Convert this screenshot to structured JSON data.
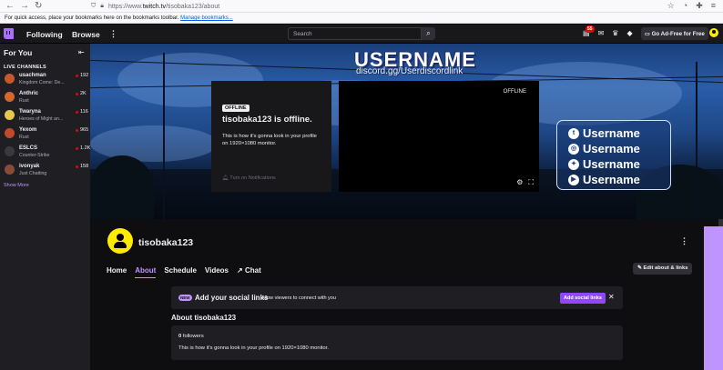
{
  "browser": {
    "url_prefix": "https://www.",
    "url_domain": "twitch.tv",
    "url_path": "/tisobaka123/about",
    "bookmarks_text": "For quick access, place your bookmarks here on the bookmarks toolbar.",
    "bookmarks_link": "Manage bookmarks..."
  },
  "topnav": {
    "following": "Following",
    "browse": "Browse",
    "search_placeholder": "Search",
    "notification_count": "55",
    "ad_free": "Go Ad-Free for Free"
  },
  "sidebar": {
    "for_you": "For You",
    "live_channels": "LIVE CHANNELS",
    "show_more": "Show More",
    "channels": [
      {
        "name": "usachman",
        "game": "Kingdom Come: De...",
        "viewers": "192",
        "color": "#c8572c"
      },
      {
        "name": "Anthric",
        "game": "Rust",
        "viewers": "2K",
        "color": "#d2692a"
      },
      {
        "name": "Twaryna",
        "game": "Heroes of Might an...",
        "viewers": "116",
        "color": "#e6c84a"
      },
      {
        "name": "Yexom",
        "game": "Rust",
        "viewers": "965",
        "color": "#c04a2a"
      },
      {
        "name": "ESLCS",
        "game": "Counter-Strike",
        "viewers": "1.2K",
        "color": "#3a3a3d"
      },
      {
        "name": "ivonyak",
        "game": "Just Chatting",
        "viewers": "158",
        "color": "#8a4a3a"
      }
    ]
  },
  "banner": {
    "title": "USERNAME",
    "discord": "discord.gg/Userdiscordlink",
    "socials": [
      {
        "icon": "tumblr-icon",
        "glyph": "t",
        "name": "Username"
      },
      {
        "icon": "instagram-icon",
        "glyph": "◎",
        "name": "Username"
      },
      {
        "icon": "twitter-icon",
        "glyph": "✦",
        "name": "Username"
      },
      {
        "icon": "youtube-icon",
        "glyph": "▶",
        "name": "Username"
      }
    ]
  },
  "offline": {
    "tag": "OFFLINE",
    "title": "tisobaka123 is offline.",
    "description": "This is how it's gonna look in your profile on 1920×1080 monitor.",
    "notifications": "Turn on Notifications",
    "player_label": "OFFLINE"
  },
  "profile": {
    "username": "tisobaka123",
    "tabs": [
      "Home",
      "About",
      "Schedule",
      "Videos",
      "Chat"
    ],
    "active_tab": "About",
    "edit_button": "Edit about & links",
    "social_banner": {
      "new": "NEW",
      "title": "Add your social links",
      "subtitle": "Allow viewers to connect with you",
      "button": "Add social links"
    },
    "about_title": "About tisobaka123",
    "followers_count": "0",
    "followers_label": "followers",
    "about_text": "This is how it's gonna look in your profile on 1920×1080 monitor."
  },
  "colors": {
    "accent": "#bf94ff",
    "brand": "#9147ff",
    "live": "#eb0400"
  }
}
